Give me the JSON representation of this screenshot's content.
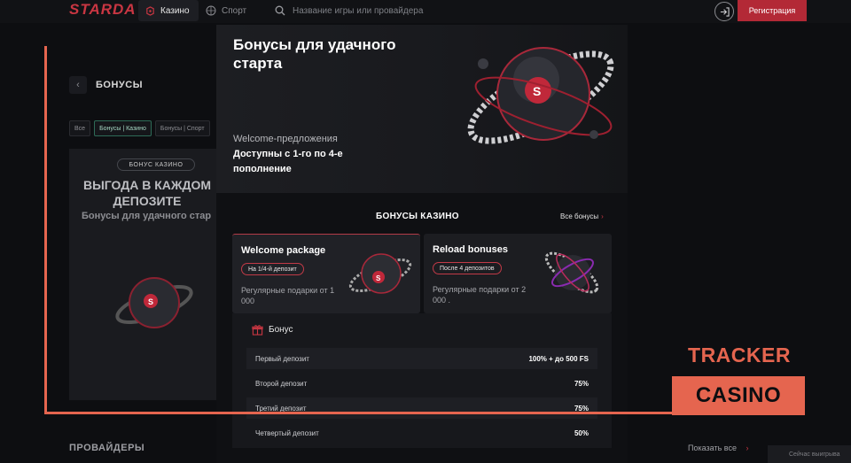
{
  "header": {
    "logo": "STARDA",
    "nav_casino": "Казино",
    "nav_sport": "Спорт",
    "search_placeholder": "Название игры или провайдера",
    "register": "Регистрация"
  },
  "background_page": {
    "title": "БОНУСЫ",
    "filters": [
      "Все",
      "Бонусы | Казино",
      "Бонусы | Спорт"
    ],
    "badge": "БОНУС КАЗИНО",
    "promo_title": "ВЫГОДА В КАЖДОМ ДЕПОЗИТЕ",
    "promo_subtitle": "Бонусы для удачного стар",
    "providers_title": "ПРОВАЙДЕРЫ",
    "show_all": "Показать все",
    "winning_now": "Сейчас выигрыва"
  },
  "modal": {
    "hero_title": "Бонусы для удачного старта",
    "hero_label": "Welcome-предложения",
    "hero_desc": "Доступны с 1-го по 4-е пополнение",
    "section_title": "БОНУСЫ КАЗИНО",
    "all_bonuses": "Все бонусы",
    "cards": [
      {
        "title": "Welcome package",
        "tag": "На 1/4-й депозит",
        "desc": "Регулярные подарки от 1 000"
      },
      {
        "title": "Reload bonuses",
        "tag": "После 4 депозитов",
        "desc": "Регулярные подарки от 2 000 ."
      }
    ],
    "bonus_title": "Бонус",
    "bonus_rows": [
      {
        "label": "Первый депозит",
        "value": "100% + до 500 FS"
      },
      {
        "label": "Второй депозит",
        "value": "75%"
      },
      {
        "label": "Третий депозит",
        "value": "75%"
      },
      {
        "label": "Четвертый депозит",
        "value": "50%"
      }
    ]
  },
  "watermark": {
    "line1": "TRACKER",
    "line2": "CASINO"
  },
  "colors": {
    "accent_red": "#b32936",
    "watermark_orange": "#e5654f",
    "background": "#0d0e11"
  }
}
